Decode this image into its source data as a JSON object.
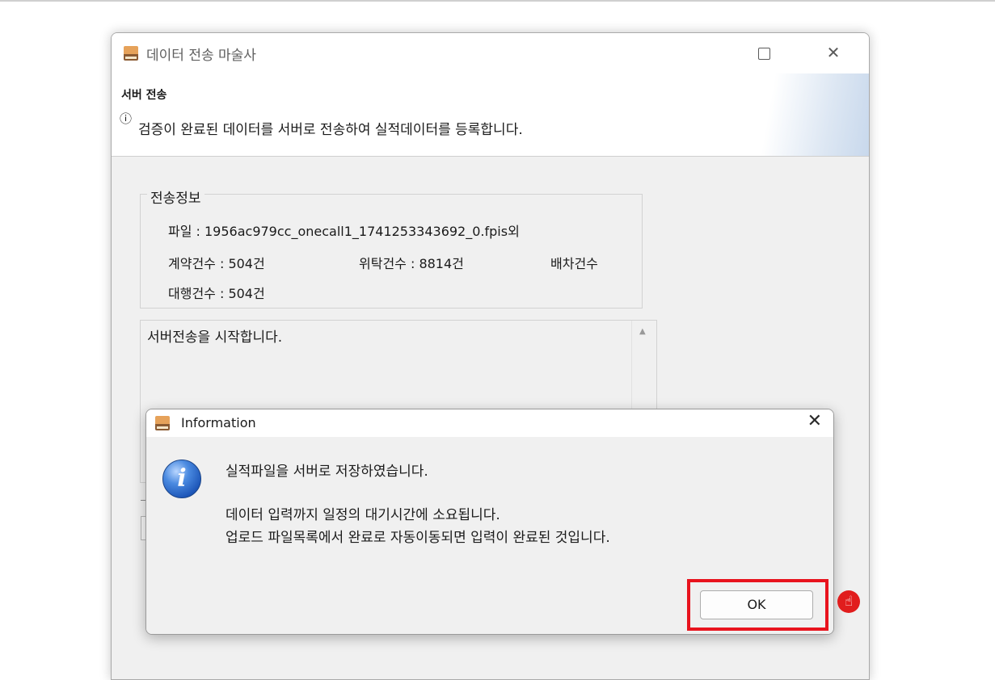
{
  "window": {
    "title": "데이터 전송 마술사",
    "maximize_icon": "maximize-icon",
    "close_glyph": "✕"
  },
  "header": {
    "heading": "서버 전송",
    "info_glyph": "ⓘ",
    "description": "검증이 완료된 데이터를 서버로 전송하여 실적데이터를 등록합니다."
  },
  "transfer_info": {
    "legend": "전송정보",
    "file": "파일 : 1956ac979cc_onecall1_1741253343692_0.fpis외",
    "contract_count": "계약건수 : 504건",
    "consign_count": "위탁건수 : 8814건",
    "dispatch_count": "배차건수",
    "agency_count": "대행건수 : 504건"
  },
  "log": {
    "text": "서버전송을 시작합니다.",
    "scroll_up_glyph": "▲"
  },
  "dialog": {
    "title": "Information",
    "close_glyph": "✕",
    "icon_glyph": "i",
    "message_line1": "실적파일을 서버로 저장하였습니다.",
    "message_line2": "데이터 입력까지 일정의 대기시간에 소요됩니다.",
    "message_line3": "업로드 파일목록에서 완료로 자동이동되면 입력이 완료된 것입니다.",
    "ok_label": "OK"
  },
  "annotation": {
    "highlight_color": "#e8131d",
    "cursor_glyph": "☝"
  }
}
